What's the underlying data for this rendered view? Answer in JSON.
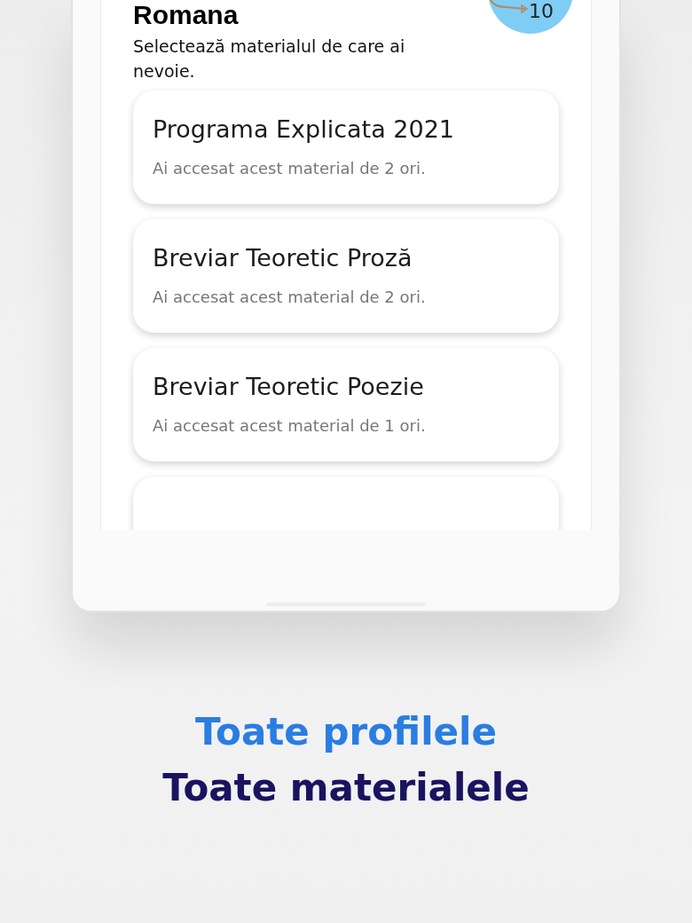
{
  "screen": {
    "title": "Romana",
    "logo_text": "10",
    "instruction": "Selectează materialul de care ai nevoie.",
    "materials": [
      {
        "title": "Programa Explicata 2021",
        "subtitle": "Ai accesat acest material de 2 ori."
      },
      {
        "title": "Breviar Teoretic Proză",
        "subtitle": "Ai accesat acest material de 2 ori."
      },
      {
        "title": "Breviar Teoretic Poezie",
        "subtitle": "Ai accesat acest material de 1 ori."
      }
    ]
  },
  "headline": {
    "primary": "Toate profilele",
    "secondary": "Toate materialele"
  }
}
